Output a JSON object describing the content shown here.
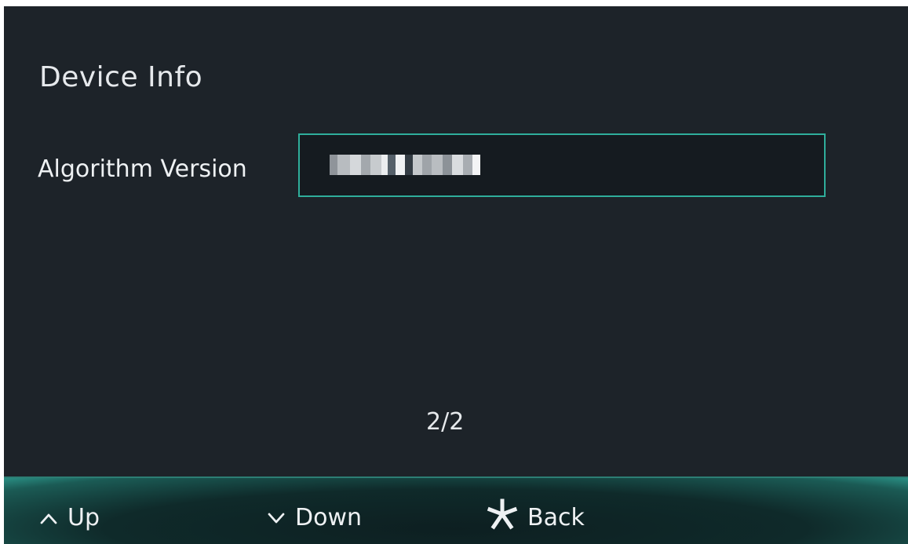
{
  "page": {
    "title": "Device Info",
    "pager": "2/2"
  },
  "field": {
    "label": "Algorithm Version",
    "value_state": "pixelated/redacted"
  },
  "footer": {
    "up_label": "Up",
    "down_label": "Down",
    "back_label": "Back",
    "up_icon": "chevron-up-icon",
    "down_icon": "chevron-down-icon",
    "back_icon": "asterisk-icon"
  },
  "colors": {
    "background": "#1d2329",
    "accent": "#2fae9b",
    "text": "#e9ecef",
    "field_bg": "#151b20"
  }
}
